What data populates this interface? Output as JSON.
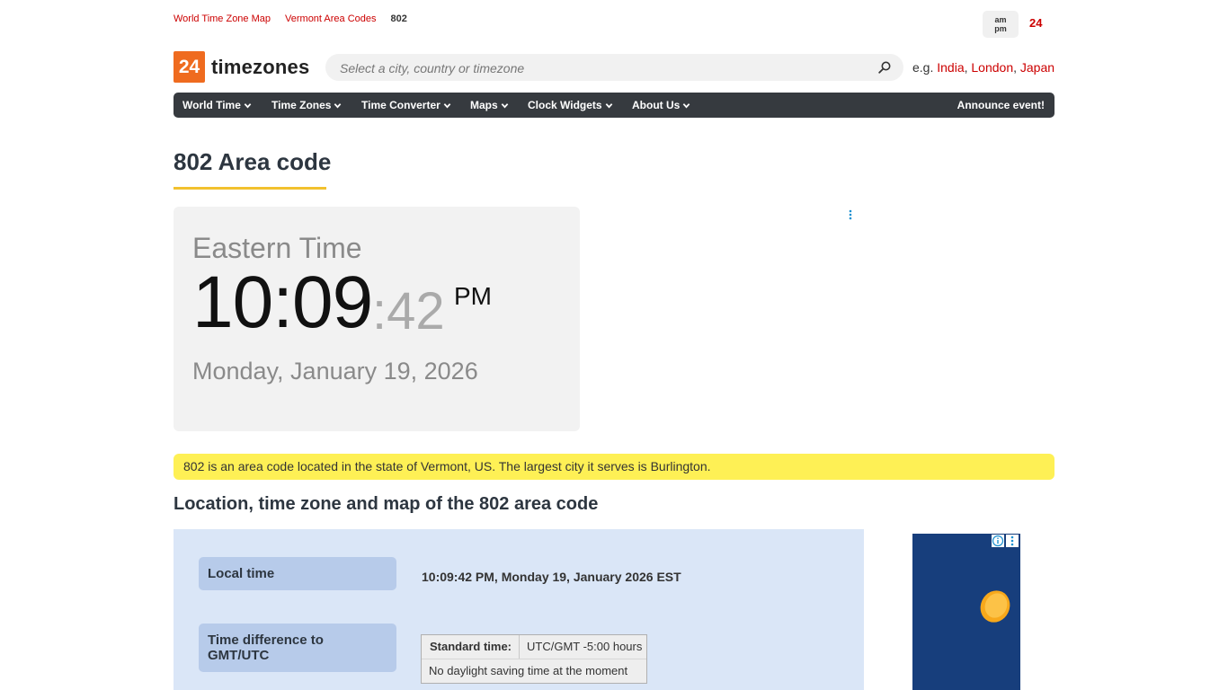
{
  "breadcrumbs": {
    "items": [
      "World Time Zone Map",
      "Vermont Area Codes"
    ],
    "current": "802"
  },
  "time_format": {
    "ampm_line1": "am",
    "ampm_line2": "pm",
    "h24": "24"
  },
  "logo": {
    "badge": "24",
    "text": "timezones"
  },
  "search": {
    "placeholder": "Select a city, country or timezone",
    "examples_prefix": "e.g.",
    "examples": [
      "India",
      "London",
      "Japan"
    ]
  },
  "menu": {
    "items": [
      "World Time",
      "Time Zones",
      "Time Converter",
      "Maps",
      "Clock Widgets",
      "About Us"
    ],
    "announce": "Announce event!"
  },
  "page_title": "802 Area code",
  "clock": {
    "timezone": "Eastern Time",
    "hhmm": "10:09",
    "seconds": ":42",
    "ampm": "PM",
    "date": "Monday, January 19, 2026"
  },
  "banner": "802 is an area code located in the state of Vermont, US. The largest city it serves is Burlington.",
  "section_title": "Location, time zone and map of the 802 area code",
  "details": {
    "local_time_label": "Local time",
    "local_time_value": "10:09:42 PM, Monday 19, January 2026 EST",
    "time_diff_label": "Time difference to GMT/UTC",
    "standard_time_label": "Standard time:",
    "standard_time_value": "UTC/GMT -5:00 hours",
    "dst_note": "No daylight saving time at the moment"
  },
  "colors": {
    "accent_red": "#cc0000",
    "logo_orange": "#ef6b1f",
    "menu_bg": "#363a3f",
    "banner_yellow": "#fef055",
    "underline_gold": "#f2c12e",
    "panel_blue": "#dae6f7",
    "ad_blue": "#173e7c"
  }
}
